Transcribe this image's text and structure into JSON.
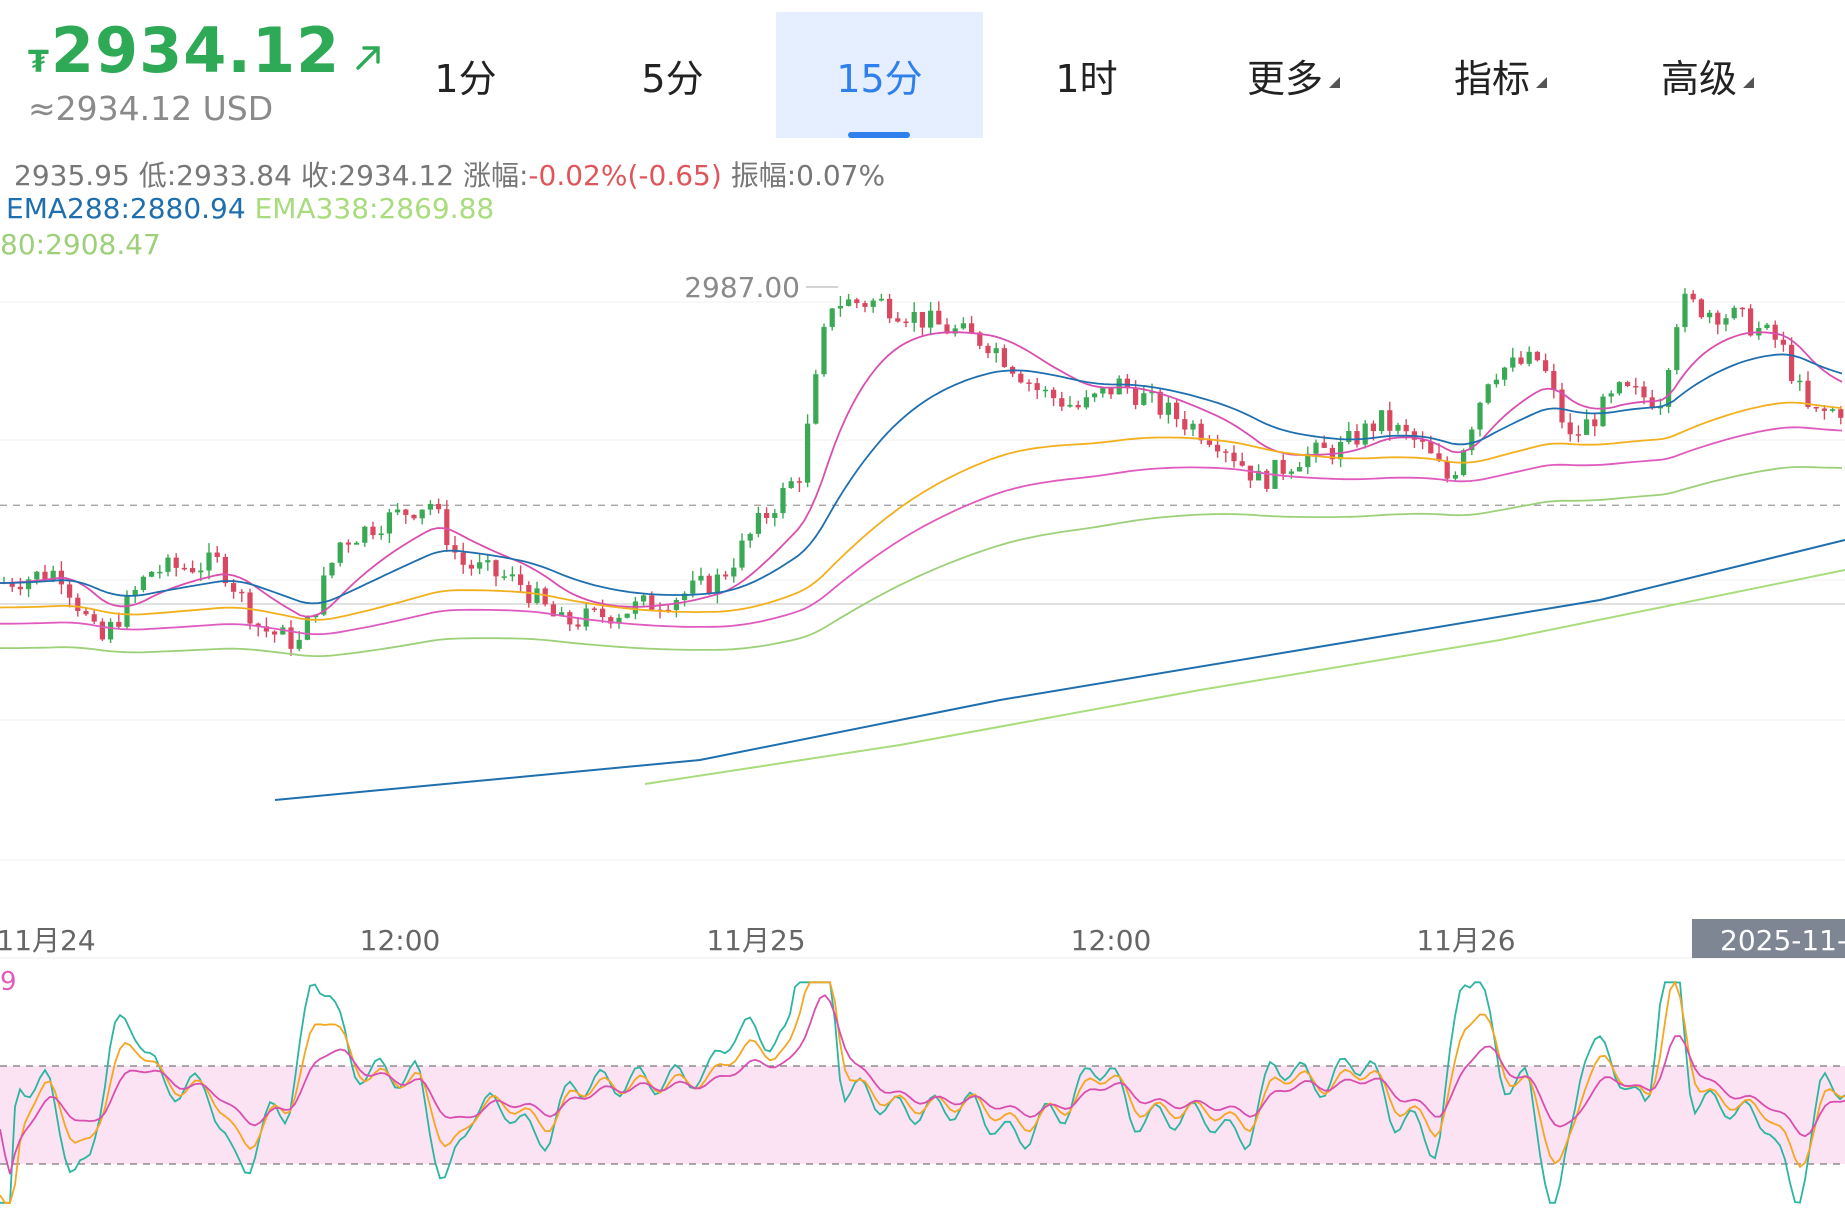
{
  "header": {
    "currency_icon": "₮",
    "price": "2934.12",
    "trend_icon": "arrow-up-right-icon",
    "approx_usd": "≈2934.12 USD",
    "price_color": "#2eaa57"
  },
  "tabs": [
    {
      "label": "1分",
      "active": false,
      "dropdown": false
    },
    {
      "label": "5分",
      "active": false,
      "dropdown": false
    },
    {
      "label": "15分",
      "active": true,
      "dropdown": false
    },
    {
      "label": "1时",
      "active": false,
      "dropdown": false
    },
    {
      "label": "更多",
      "active": false,
      "dropdown": true
    },
    {
      "label": "指标",
      "active": false,
      "dropdown": true
    },
    {
      "label": "高级",
      "active": false,
      "dropdown": true
    }
  ],
  "info": {
    "high_value": "2935.95",
    "low_label": "低:",
    "low_value": "2933.84",
    "close_label": "收:",
    "close_value": "2934.12",
    "change_label": "涨幅:",
    "change_value": "-0.02%(-0.65)",
    "amplitude_label": "振幅:",
    "amplitude_value": "0.07%"
  },
  "ema": {
    "ema288": "EMA288:2880.94",
    "ema338": "EMA338:2869.88",
    "ema180_partial": "80:2908.47"
  },
  "chart_data": {
    "type": "candlestick",
    "interval": "15分",
    "max_label": "2987.00",
    "current_price": 2934.12,
    "x_ticks": [
      "11月24",
      "12:00",
      "11月25",
      "12:00",
      "11月26",
      "2025-11-"
    ],
    "colors": {
      "up": "#3aa955",
      "down": "#d94860",
      "ema_fast": "#d94fb0",
      "ema_mid": "#1f6fae",
      "ema_yellow": "#f2b01e",
      "ema_pink": "#e05bbf",
      "ema_green": "#9ed07a",
      "ema_288": "#1f6fae",
      "ema_338": "#a9dc7c",
      "rsi_band": "#fbe3f3"
    },
    "overlay_lines": [
      "EMA288",
      "EMA338",
      "EMA (magenta)",
      "EMA (blue)",
      "EMA (yellow)",
      "EMA (pink)",
      "EMA (light green)"
    ],
    "oscillator": {
      "upper_level": 80,
      "lower_level": 20,
      "label": "9",
      "lines": [
        "teal",
        "orange",
        "magenta"
      ]
    }
  }
}
